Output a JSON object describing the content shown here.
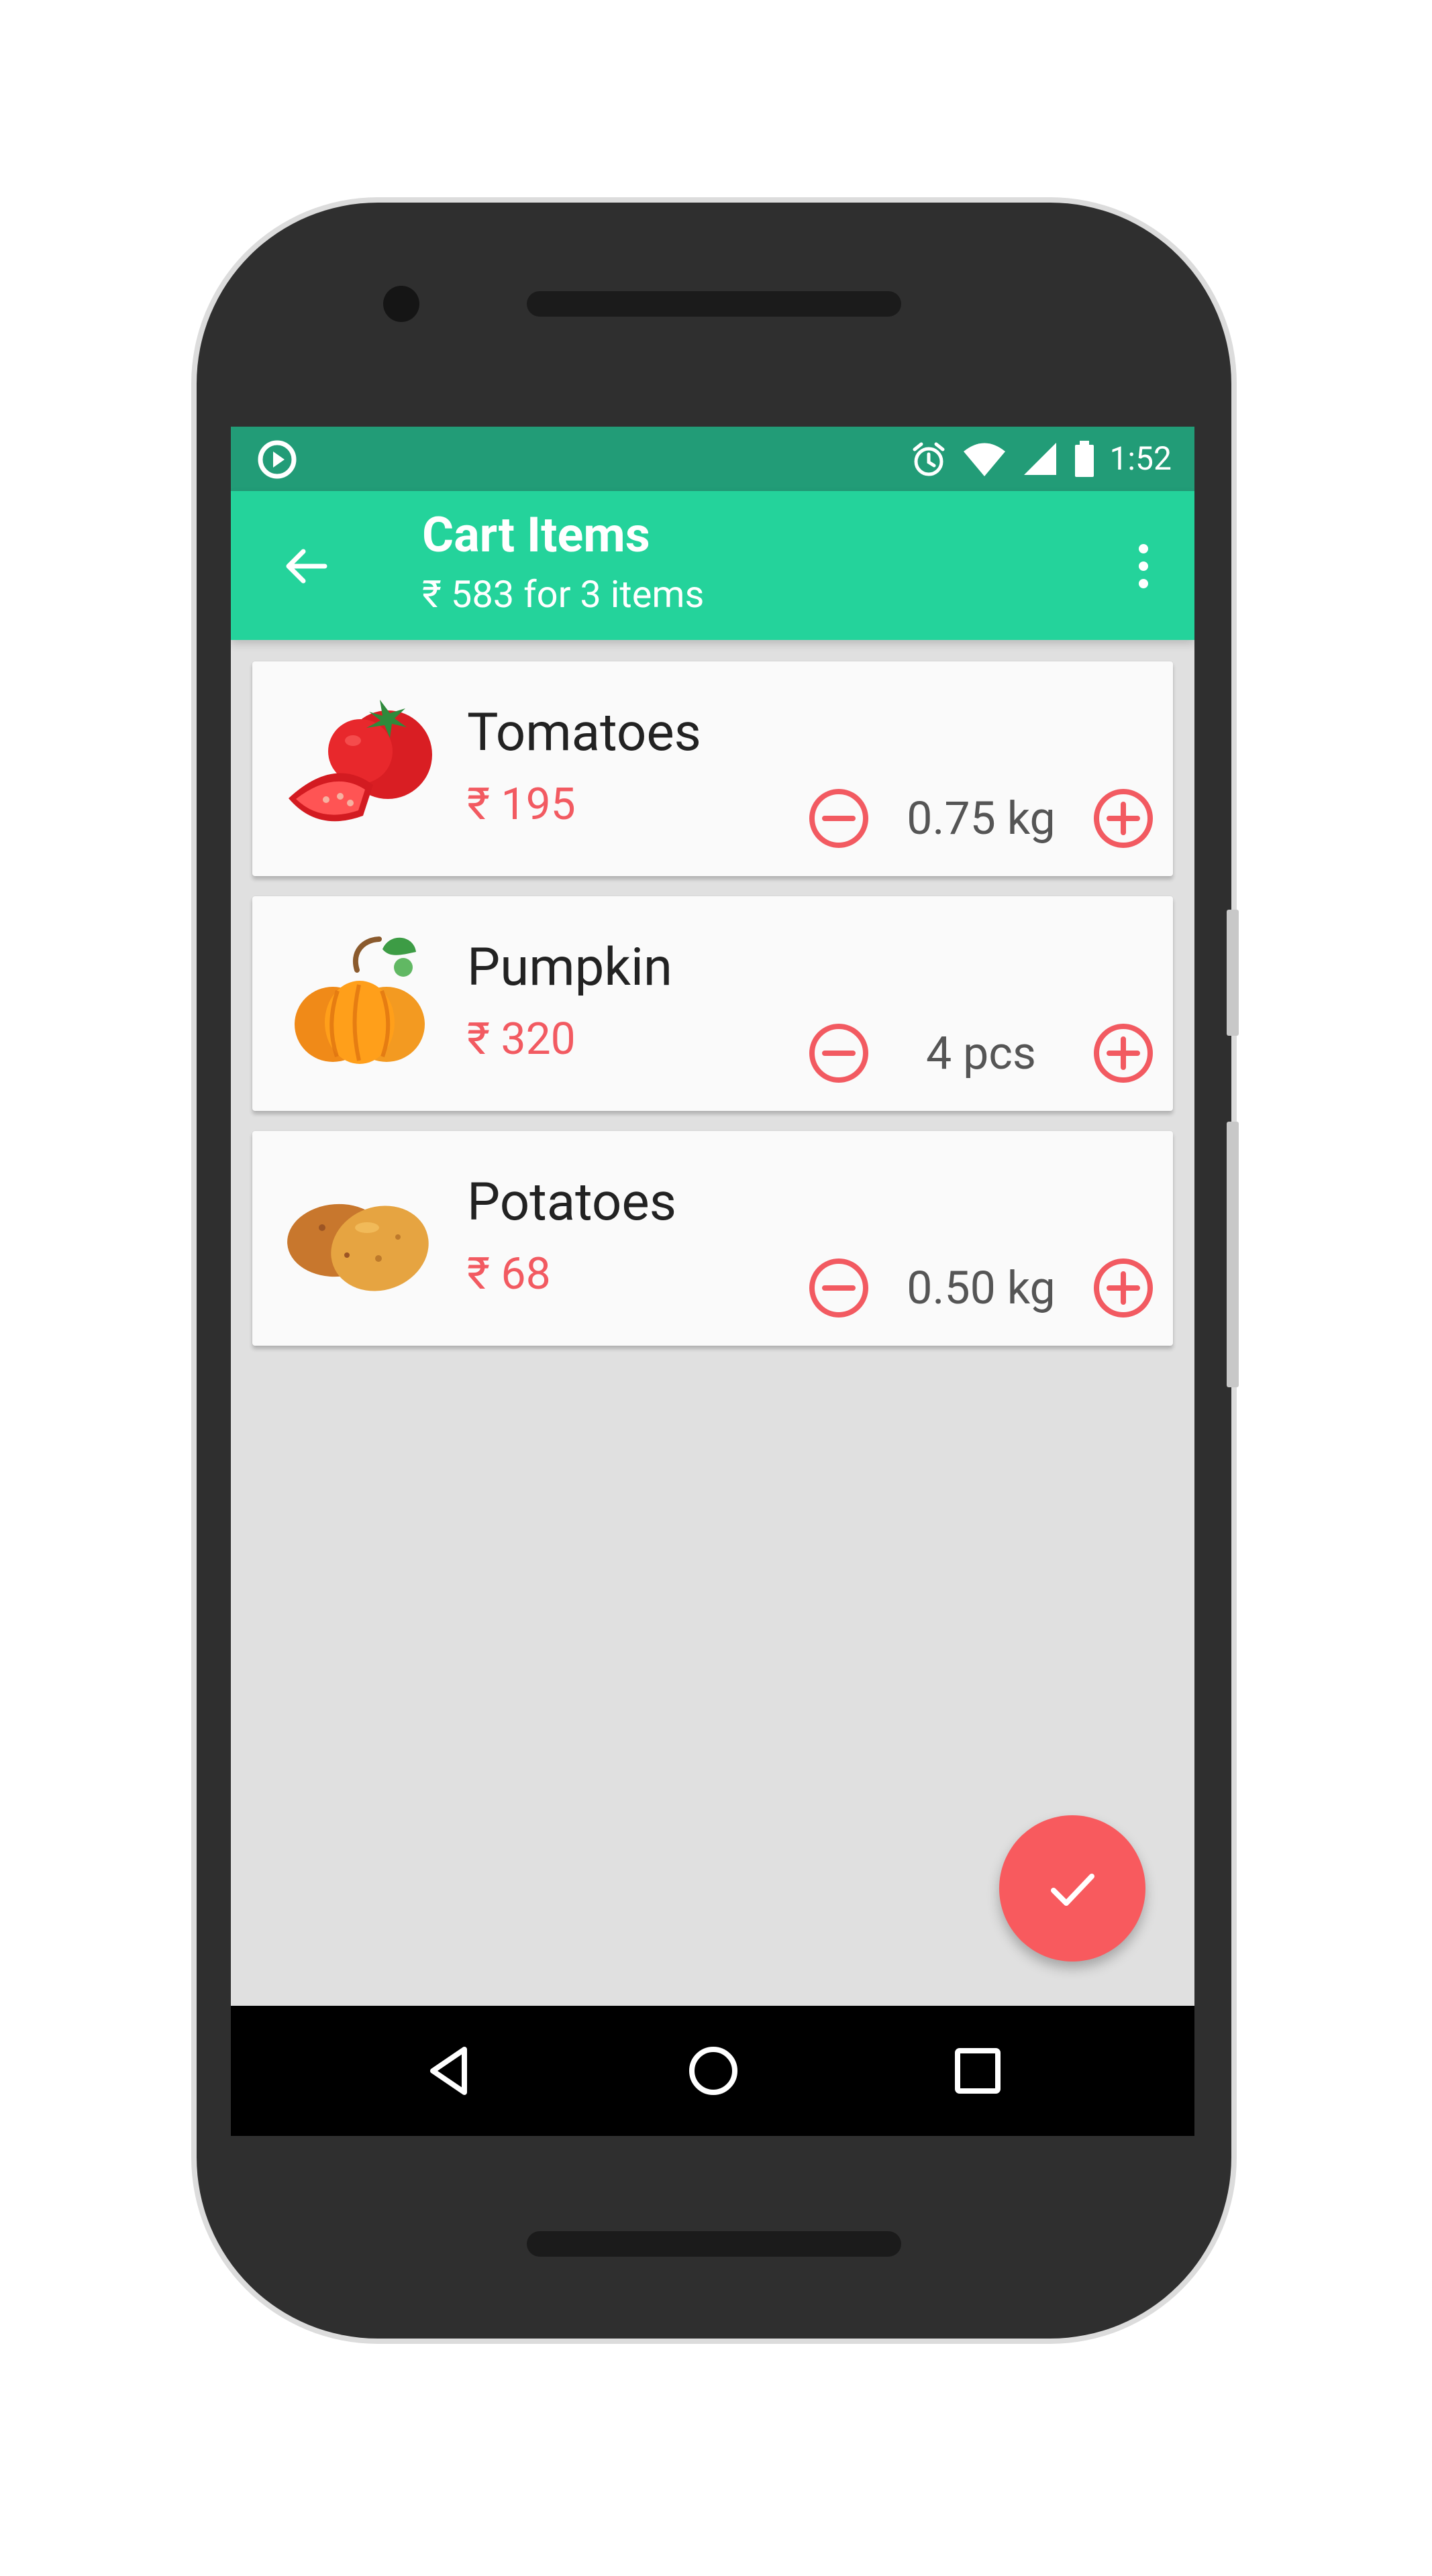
{
  "status_bar": {
    "time": "1:52",
    "icons": [
      "play-icon",
      "alarm-icon",
      "wifi-icon",
      "signal-icon",
      "battery-icon"
    ]
  },
  "app_bar": {
    "title": "Cart Items",
    "subtitle": "₹ 583 for 3 items",
    "back_icon": "arrow-left-icon",
    "more_icon": "more-vertical-icon"
  },
  "cart": {
    "items": [
      {
        "name": "Tomatoes",
        "price": "₹ 195",
        "quantity": "0.75 kg",
        "image_icon": "tomato-icon"
      },
      {
        "name": "Pumpkin",
        "price": "₹ 320",
        "quantity": "4 pcs",
        "image_icon": "pumpkin-icon"
      },
      {
        "name": "Potatoes",
        "price": "₹ 68",
        "quantity": "0.50 kg",
        "image_icon": "potato-icon"
      }
    ]
  },
  "fab": {
    "icon": "check-icon"
  },
  "navigation": {
    "icons": [
      "back-triangle-icon",
      "home-circle-icon",
      "recents-square-icon"
    ]
  },
  "colors": {
    "status_bar": "#229c77",
    "app_bar": "#24d39b",
    "accent": "#f25a61",
    "screen_background": "#e0e0e0",
    "card_background": "#fafafa",
    "phone_body": "#2f2f2f",
    "navigation_bar": "#000000"
  }
}
